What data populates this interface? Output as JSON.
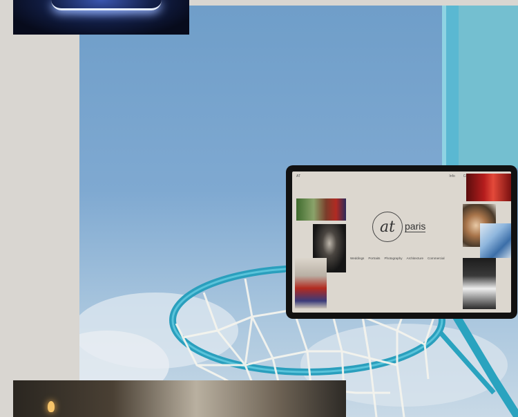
{
  "tablet_site": {
    "logo_mark": "at",
    "logo_word": "paris",
    "top_left": "AT",
    "top_right": [
      "Info",
      "Contact"
    ],
    "nav": [
      "Weddings",
      "Portraits",
      "Photography",
      "Architecture",
      "Commercial"
    ]
  }
}
